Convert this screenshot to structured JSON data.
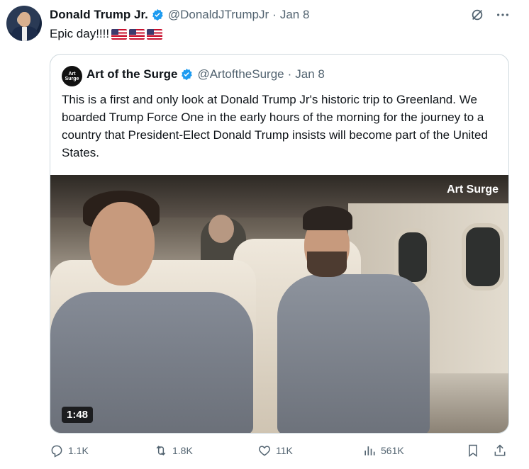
{
  "tweet": {
    "author_name": "Donald Trump Jr.",
    "author_handle": "@DonaldJTrumpJr",
    "separator": "·",
    "date": "Jan 8",
    "text": "Epic day!!!!",
    "flags": [
      "us-flag",
      "us-flag",
      "us-flag"
    ]
  },
  "quote": {
    "avatar_text": "Art Surge",
    "author_name": "Art of the Surge",
    "author_handle": "@ArtoftheSurge",
    "separator": "·",
    "date": "Jan 8",
    "text": "This is a first and only look at Donald Trump Jr's historic trip to Greenland. We boarded Trump Force One in the early hours of the morning for the journey to a country that President-Elect Donald Trump insists will become part of the United States.",
    "video": {
      "logo": "Art Surge",
      "duration": "1:48"
    }
  },
  "actions": {
    "replies": "1.1K",
    "reposts": "1.8K",
    "likes": "11K",
    "views": "561K"
  },
  "colors": {
    "text": "#0f1419",
    "secondary": "#536471",
    "verified": "#1d9bf0",
    "border": "#cfd9de"
  },
  "icons": [
    "verified-badge-icon",
    "grok-icon",
    "more-icon",
    "reply-icon",
    "repost-icon",
    "like-icon",
    "views-icon",
    "bookmark-icon",
    "share-icon"
  ]
}
